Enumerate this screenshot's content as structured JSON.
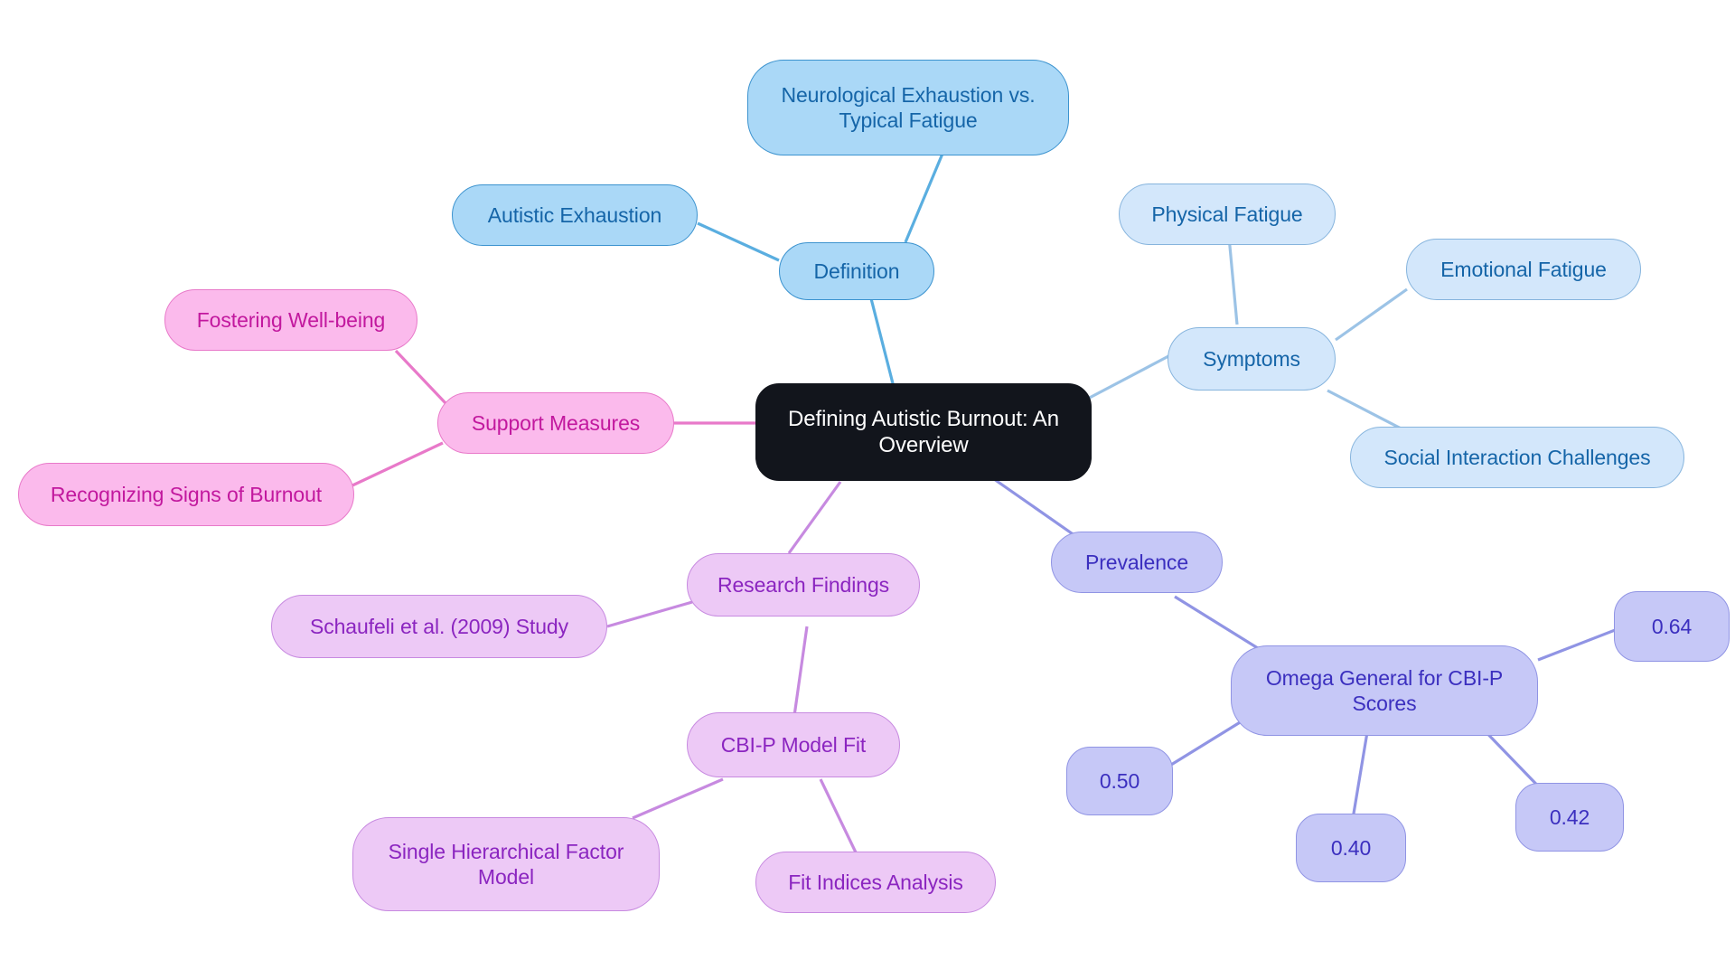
{
  "diagram": {
    "type": "mindmap",
    "title": "Defining Autistic Burnout: An Overview",
    "background": "#ffffff"
  },
  "palette": {
    "root_fill": "#12151c",
    "root_text": "#ffffff",
    "blue_dark_fill": "#aad8f7",
    "blue_dark_stroke": "#3c93cf",
    "blue_dark_text": "#1565a8",
    "blue_light_fill": "#d3e7fb",
    "blue_light_stroke": "#86b4dd",
    "pink_fill": "#fbbaec",
    "pink_stroke": "#e879c9",
    "pink_text": "#c2189e",
    "violet_fill": "#edc9f6",
    "violet_stroke": "#c78ae0",
    "violet_text": "#8b25c0",
    "periwinkle_fill": "#c6c8f7",
    "periwinkle_stroke": "#9094e4",
    "periwinkle_text": "#3b2fbf"
  },
  "nodes": {
    "root": {
      "label": "Defining Autistic Burnout: An\nOverview"
    },
    "definition": {
      "label": "Definition"
    },
    "neurological": {
      "label": "Neurological Exhaustion vs.\nTypical Fatigue"
    },
    "autistic_exhaustion": {
      "label": "Autistic Exhaustion"
    },
    "symptoms": {
      "label": "Symptoms"
    },
    "physical_fatigue": {
      "label": "Physical Fatigue"
    },
    "emotional_fatigue": {
      "label": "Emotional Fatigue"
    },
    "social_interaction": {
      "label": "Social Interaction Challenges"
    },
    "prevalence": {
      "label": "Prevalence"
    },
    "omega_general": {
      "label": "Omega General for CBI-P\nScores"
    },
    "score_064": {
      "label": "0.64"
    },
    "score_050": {
      "label": "0.50"
    },
    "score_040": {
      "label": "0.40"
    },
    "score_042": {
      "label": "0.42"
    },
    "support_measures": {
      "label": "Support Measures"
    },
    "fostering_wellbeing": {
      "label": "Fostering Well-being"
    },
    "recognizing_signs": {
      "label": "Recognizing Signs of Burnout"
    },
    "research_findings": {
      "label": "Research Findings"
    },
    "schaufeli_study": {
      "label": "Schaufeli et al. (2009) Study"
    },
    "cbip_model_fit": {
      "label": "CBI-P Model Fit"
    },
    "single_hierarchical": {
      "label": "Single Hierarchical Factor\nModel"
    },
    "fit_indices": {
      "label": "Fit Indices Analysis"
    }
  },
  "branches": [
    {
      "name": "Definition",
      "color": "#3c93cf",
      "children": [
        "Neurological Exhaustion vs. Typical Fatigue",
        "Autistic Exhaustion"
      ]
    },
    {
      "name": "Symptoms",
      "color": "#86b4dd",
      "children": [
        "Physical Fatigue",
        "Emotional Fatigue",
        "Social Interaction Challenges"
      ]
    },
    {
      "name": "Prevalence",
      "color": "#9094e4",
      "children": [
        "Omega General for CBI-P Scores"
      ]
    },
    {
      "name": "Omega General for CBI-P Scores",
      "color": "#9094e4",
      "children": [
        "0.64",
        "0.50",
        "0.40",
        "0.42"
      ]
    },
    {
      "name": "Support Measures",
      "color": "#e879c9",
      "children": [
        "Fostering Well-being",
        "Recognizing Signs of Burnout"
      ]
    },
    {
      "name": "Research Findings",
      "color": "#c78ae0",
      "children": [
        "Schaufeli et al. (2009) Study",
        "CBI-P Model Fit"
      ]
    },
    {
      "name": "CBI-P Model Fit",
      "color": "#c78ae0",
      "children": [
        "Single Hierarchical Factor Model",
        "Fit Indices Analysis"
      ]
    }
  ]
}
